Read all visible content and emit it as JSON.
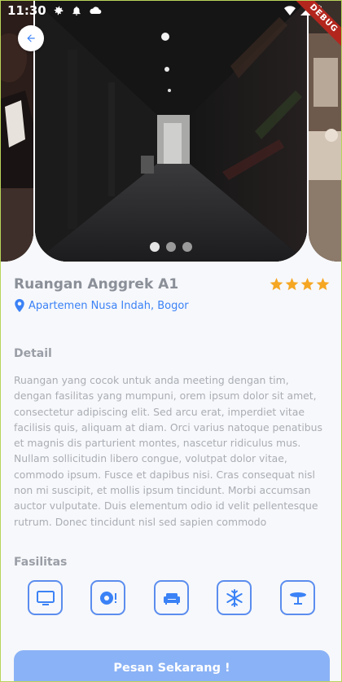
{
  "status": {
    "time": "11:30",
    "debug": "DEBUG"
  },
  "carousel": {
    "slide_count": 3,
    "active_index": 0
  },
  "room": {
    "title": "Ruangan Anggrek A1",
    "rating": 4,
    "location": "Apartemen Nusa Indah, Bogor"
  },
  "detail": {
    "heading": "Detail",
    "text": "Ruangan yang cocok untuk anda meeting dengan tim, dengan fasilitas yang mumpuni, orem ipsum dolor sit amet, consectetur adipiscing elit. Sed arcu erat, imperdiet vitae facilisis quis, aliquam at diam. Orci varius natoque penatibus et magnis dis parturient montes, nascetur ridiculus mus. Nullam sollicitudin libero congue, volutpat dolor vitae, commodo ipsum. Fusce et dapibus nisi. Cras consequat nisl non mi suscipit, et mollis ipsum tincidunt. Morbi accumsan auctor vulputate. Duis elementum odio id velit pellentesque rutrum. Donec tincidunt nisl sed sapien commodo"
  },
  "facilities": {
    "heading": "Fasilitas",
    "items": [
      {
        "icon": "tv-icon"
      },
      {
        "icon": "speaker-icon"
      },
      {
        "icon": "sofa-icon"
      },
      {
        "icon": "ac-snowflake-icon"
      },
      {
        "icon": "table-icon"
      }
    ]
  },
  "action": {
    "book_label": "Pesan Sekarang !"
  },
  "colors": {
    "accent": "#3b82f6",
    "button": "#8ab2f6",
    "star": "#f5a623"
  }
}
